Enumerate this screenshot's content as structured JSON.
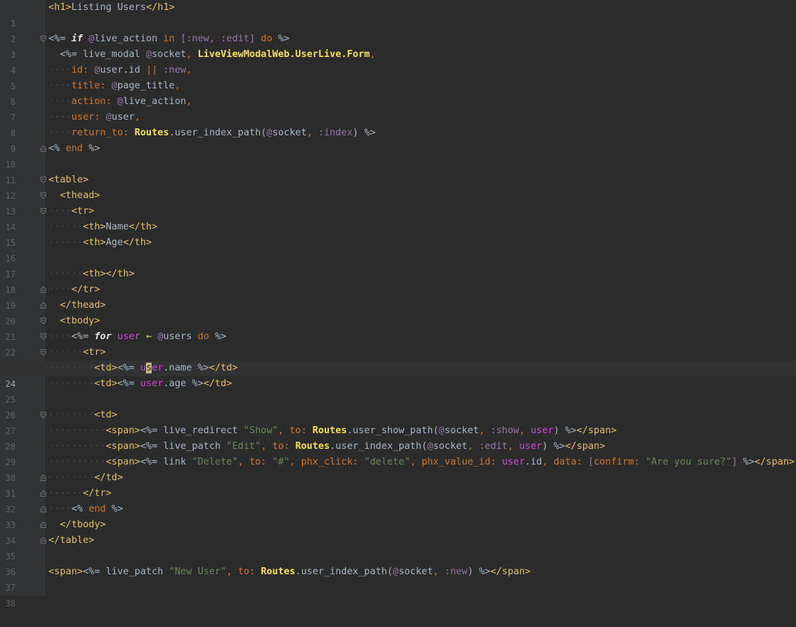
{
  "editor": {
    "current_line": 24,
    "lines": [
      {
        "n": "1"
      },
      {
        "n": "2"
      },
      {
        "n": "3"
      },
      {
        "n": "4"
      },
      {
        "n": "5"
      },
      {
        "n": "6"
      },
      {
        "n": "7"
      },
      {
        "n": "8"
      },
      {
        "n": "9"
      },
      {
        "n": "10"
      },
      {
        "n": "11"
      },
      {
        "n": "12"
      },
      {
        "n": "13"
      },
      {
        "n": "14"
      },
      {
        "n": "15"
      },
      {
        "n": "16"
      },
      {
        "n": "17"
      },
      {
        "n": "18"
      },
      {
        "n": "19"
      },
      {
        "n": "20"
      },
      {
        "n": "21"
      },
      {
        "n": "22"
      },
      {
        "n": "23"
      },
      {
        "n": "24"
      },
      {
        "n": "25"
      },
      {
        "n": "26"
      },
      {
        "n": "27"
      },
      {
        "n": "28"
      },
      {
        "n": "29"
      },
      {
        "n": "30"
      },
      {
        "n": "31"
      },
      {
        "n": "32"
      },
      {
        "n": "33"
      },
      {
        "n": "34"
      },
      {
        "n": "35"
      },
      {
        "n": "36"
      },
      {
        "n": "37"
      },
      {
        "n": "38"
      }
    ]
  },
  "code": {
    "l1": [
      "<h1>",
      "Listing Users",
      "</h1>"
    ],
    "l3": [
      "<%=",
      "if",
      "@",
      "live_action",
      "in",
      "[:new, :edit]",
      "do",
      "%>"
    ],
    "l4": [
      "<%=",
      "live_modal",
      "@",
      "socket",
      ",",
      "LiveViewModalWeb.UserLive.Form",
      ","
    ],
    "l5": [
      "id:",
      "@",
      "user",
      ".id",
      "||",
      ":new",
      ","
    ],
    "l6": [
      "title:",
      "@",
      "page_title",
      ","
    ],
    "l7": [
      "action:",
      "@",
      "live_action",
      ","
    ],
    "l8": [
      "user:",
      "@",
      "user",
      ","
    ],
    "l9": [
      "return_to:",
      "Routes",
      ".user_index_path(",
      "@",
      "socket",
      ",",
      ":index",
      ")",
      "%>"
    ],
    "l10": [
      "<%",
      "end",
      "%>"
    ],
    "l12": [
      "<table>"
    ],
    "l13": [
      "<thead>"
    ],
    "l14": [
      "<tr>"
    ],
    "l15": [
      "<th>",
      "Name",
      "</th>"
    ],
    "l16": [
      "<th>",
      "Age",
      "</th>"
    ],
    "l18": [
      "<th>",
      "</th>"
    ],
    "l19": [
      "</tr>"
    ],
    "l20": [
      "</thead>"
    ],
    "l21": [
      "<tbody>"
    ],
    "l22": [
      "<%=",
      "for",
      "user",
      "←",
      "@",
      "users",
      "do",
      "%>"
    ],
    "l23": [
      "<tr>"
    ],
    "l24": [
      "<td>",
      "<%=",
      "u",
      "s",
      "er",
      ".name",
      "%>",
      "</td>"
    ],
    "l25": [
      "<td>",
      "<%=",
      "user",
      ".age",
      "%>",
      "</td>"
    ],
    "l27": [
      "<td>"
    ],
    "l28": [
      "<span>",
      "<%=",
      "live_redirect",
      "\"Show\"",
      ",",
      "to:",
      "Routes",
      ".user_show_path(",
      "@",
      "socket",
      ",",
      ":show",
      ",",
      "user",
      ")",
      "%>",
      "</span>"
    ],
    "l29": [
      "<span>",
      "<%=",
      "live_patch",
      "\"Edit\"",
      ",",
      "to:",
      "Routes",
      ".user_index_path(",
      "@",
      "socket",
      ",",
      ":edit",
      ",",
      "user",
      ")",
      "%>",
      "</span>"
    ],
    "l30": [
      "<span>",
      "<%=",
      "link",
      "\"Delete\"",
      ",",
      "to:",
      "\"#\"",
      ",",
      "phx_click:",
      "\"delete\"",
      ",",
      "phx_value_id:",
      "user",
      ".id",
      ",",
      "data:",
      "[",
      "confirm:",
      "\"Are you sure?\"",
      "]",
      "%>",
      "</span>"
    ],
    "l31": [
      "</td>"
    ],
    "l32": [
      "</tr>"
    ],
    "l33": [
      "<%",
      "end",
      "%>"
    ],
    "l34": [
      "</tbody>"
    ],
    "l35": [
      "</table>"
    ],
    "l37": [
      "<span>",
      "<%=",
      "live_patch",
      "\"New User\"",
      ",",
      "to:",
      "Routes",
      ".user_index_path(",
      "@",
      "socket",
      ",",
      ":new",
      ")",
      "%>",
      "</span>"
    ]
  },
  "colors": {
    "background": "#2b2b2b",
    "gutter": "#313335",
    "tag": "#e8bf6a",
    "keyword": "#cc7832",
    "instance_var": "#9876aa",
    "string": "#6a8759",
    "module": "#ffc66d",
    "user_var": "#d645d6"
  }
}
